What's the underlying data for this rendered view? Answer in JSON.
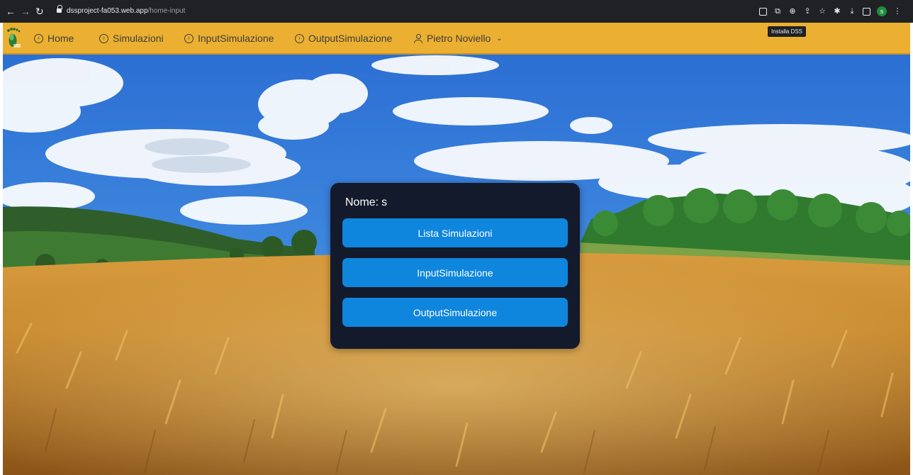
{
  "browser": {
    "url_host": "dssproject-fa053.web.app",
    "url_path": "/home-input",
    "install_tooltip": "Installa DSS",
    "profile_initial": "s"
  },
  "nav": {
    "items": [
      {
        "label": "Home"
      },
      {
        "label": "Simulazioni"
      },
      {
        "label": "InputSimulazione"
      },
      {
        "label": "OutputSimulazione"
      }
    ],
    "user": {
      "label": "Pietro Noviello"
    },
    "accent_color": "#ebb031"
  },
  "card": {
    "name_label": "Nome:",
    "name_value": "s",
    "buttons": [
      {
        "label": "Lista Simulazioni"
      },
      {
        "label": "InputSimulazione"
      },
      {
        "label": "OutputSimulazione"
      }
    ],
    "background_color": "#131a2b",
    "button_color": "#0f86dd"
  }
}
